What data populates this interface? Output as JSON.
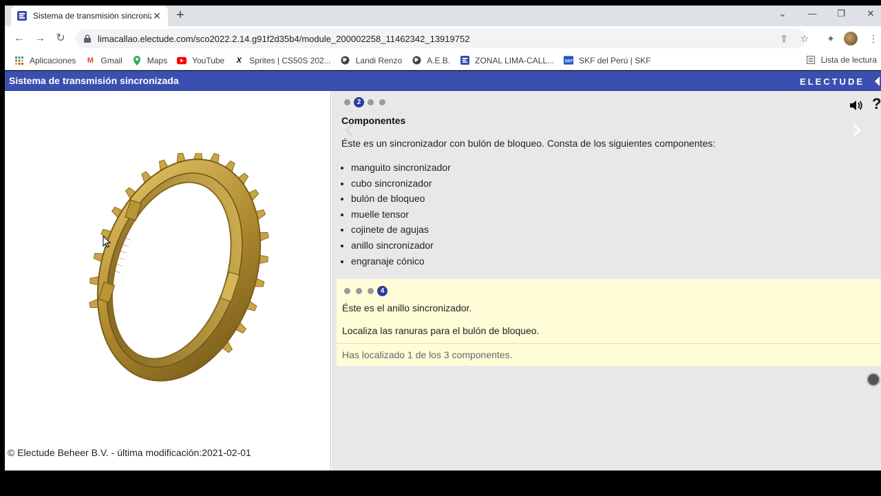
{
  "browser": {
    "tab_title": "Sistema de transmisión sincroniz",
    "url": "limacallao.electude.com/sco2022.2.14.g91f2d35b4/module_200002258_11462342_13919752",
    "bookmarks": [
      {
        "label": "Aplicaciones",
        "icon": "apps-grid-icon"
      },
      {
        "label": "Gmail",
        "icon": "gmail-icon"
      },
      {
        "label": "Maps",
        "icon": "maps-pin-icon"
      },
      {
        "label": "YouTube",
        "icon": "youtube-icon"
      },
      {
        "label": "Sprites | CS50S 202...",
        "icon": "cs50-icon"
      },
      {
        "label": "Landi Renzo",
        "icon": "globe-icon"
      },
      {
        "label": "A.E.B.",
        "icon": "globe-icon"
      },
      {
        "label": "ZONAL LIMA-CALL...",
        "icon": "electude-icon"
      },
      {
        "label": "SKF del Perú | SKF",
        "icon": "skf-icon"
      }
    ],
    "reading_list": "Lista de lectura"
  },
  "header": {
    "title": "Sistema de transmisión sincronizada",
    "brand": "ELECTUDE"
  },
  "left": {
    "copyright": "© Electude Beheer B.V. - última modificación:2021-02-01"
  },
  "info": {
    "active_step": "2",
    "title": "Componentes",
    "intro": "Éste es un sincronizador con bulón de bloqueo. Consta de los siguientes componentes:",
    "components": [
      "manguito sincronizador",
      "cubo sincronizador",
      "bulón de bloqueo",
      "muelle tensor",
      "cojinete de agujas",
      "anillo sincronizador",
      "engranaje cónico"
    ]
  },
  "task": {
    "active_step": "4",
    "sentence": "Éste es el anillo sincronizador.",
    "instruction": "Localiza las ranuras para el bulón de bloqueo.",
    "status": "Has localizado 1 de los 3 componentes."
  },
  "help_label": "?",
  "colors": {
    "header_bg": "#3a4fb0",
    "task_bg": "#fffdd8",
    "panel_bg": "#e8e8e8",
    "step_active": "#2a3c9c"
  }
}
